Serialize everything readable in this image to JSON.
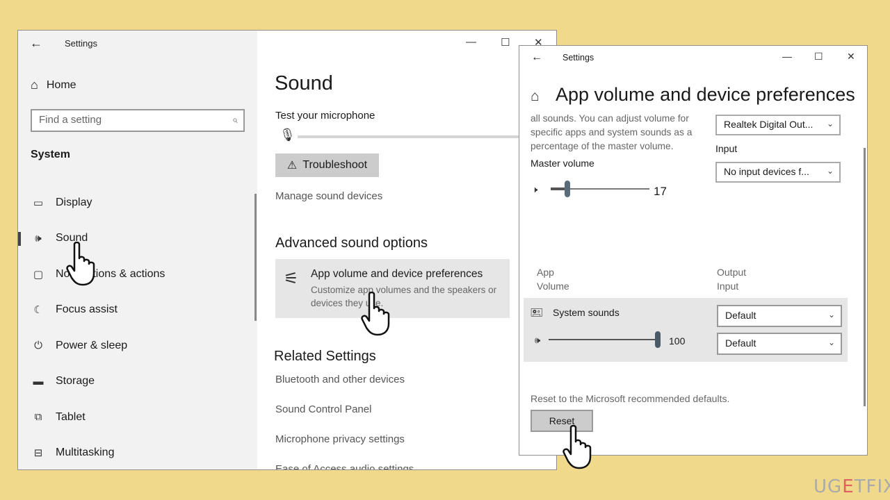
{
  "left_window": {
    "title": "Settings",
    "back_icon": "←",
    "minimize_icon": "—",
    "maximize_icon": "☐",
    "close_icon": "✕",
    "sidebar": {
      "home_label": "Home",
      "home_icon": "⌂",
      "search_placeholder": "Find a setting",
      "search_icon": "⌕",
      "section_title": "System",
      "items": [
        {
          "label": "Display",
          "icon": "▭"
        },
        {
          "label": "Sound",
          "icon": "🕪",
          "active": true
        },
        {
          "label": "Notifications & actions",
          "icon": "▢"
        },
        {
          "label": "Focus assist",
          "icon": "☾"
        },
        {
          "label": "Power & sleep",
          "icon": "⏻"
        },
        {
          "label": "Storage",
          "icon": "▬"
        },
        {
          "label": "Tablet",
          "icon": "⧉"
        },
        {
          "label": "Multitasking",
          "icon": "⊟"
        }
      ]
    },
    "main": {
      "title": "Sound",
      "test_mic_label": "Test your microphone",
      "mic_icon": "🎙",
      "troubleshoot_label": "Troubleshoot",
      "troubleshoot_icon": "⚠",
      "manage_link": "Manage sound devices",
      "advanced_heading": "Advanced sound options",
      "app_card": {
        "icon": "⚟",
        "title": "App volume and device preferences",
        "description": "Customize app volumes and the speakers or devices they use."
      },
      "related_heading": "Related Settings",
      "related_links": [
        "Bluetooth and other devices",
        "Sound Control Panel",
        "Microphone privacy settings",
        "Ease of Access audio settings"
      ]
    }
  },
  "right_window": {
    "title": "Settings",
    "back_icon": "←",
    "minimize_icon": "—",
    "maximize_icon": "☐",
    "close_icon": "✕",
    "home_icon": "⌂",
    "heading": "App volume and device preferences",
    "description": "all sounds. You can adjust volume for specific apps and system sounds as a percentage of the master volume.",
    "output_select": "Realtek Digital Out...",
    "input_label": "Input",
    "input_select": "No input devices f...",
    "master_volume_label": "Master volume",
    "master_volume_value": "17",
    "master_volume_level": 17,
    "col_app": "App",
    "col_volume": "Volume",
    "col_output": "Output",
    "col_input": "Input",
    "system_sounds_label": "System sounds",
    "system_output": "Default",
    "system_input": "Default",
    "system_volume_value": "100",
    "system_volume_level": 100,
    "reset_text": "Reset to the Microsoft recommended defaults.",
    "reset_button": "Reset",
    "chevron_icon": "⌄"
  },
  "watermark": {
    "prefix": "UG",
    "accent": "E",
    "suffix": "TFIX"
  }
}
